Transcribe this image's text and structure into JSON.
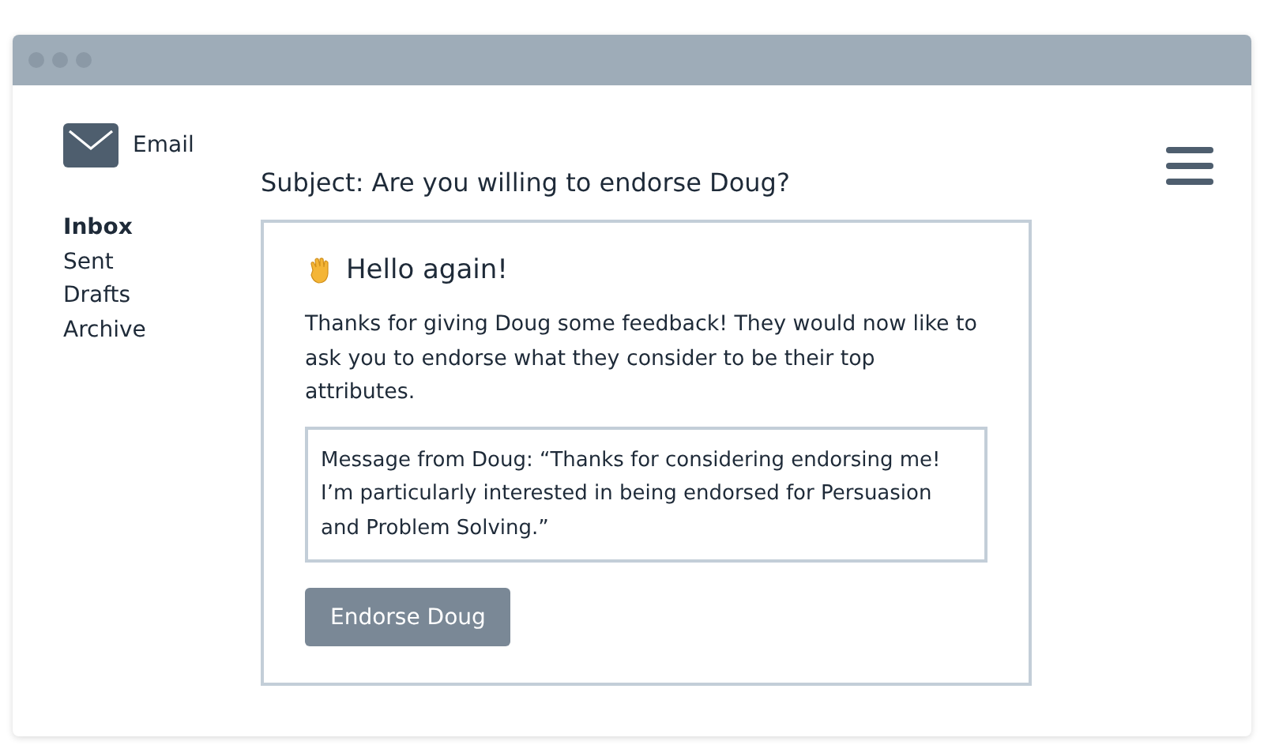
{
  "app": {
    "title": "Email"
  },
  "sidebar": {
    "items": [
      {
        "label": "Inbox",
        "selected": true
      },
      {
        "label": "Sent",
        "selected": false
      },
      {
        "label": "Drafts",
        "selected": false
      },
      {
        "label": "Archive",
        "selected": false
      }
    ]
  },
  "email": {
    "subject": "Subject: Are you willing to endorse Doug?",
    "greeting": "Hello again!",
    "body": "Thanks for giving Doug some feedback! They would now like to ask you to endorse what they consider to be their top attributes.",
    "quote": "Message from Doug: “Thanks for considering endorsing me! I’m particularly interested in being endorsed for Persuasion and Problem Solving.”",
    "button": "Endorse Doug"
  }
}
